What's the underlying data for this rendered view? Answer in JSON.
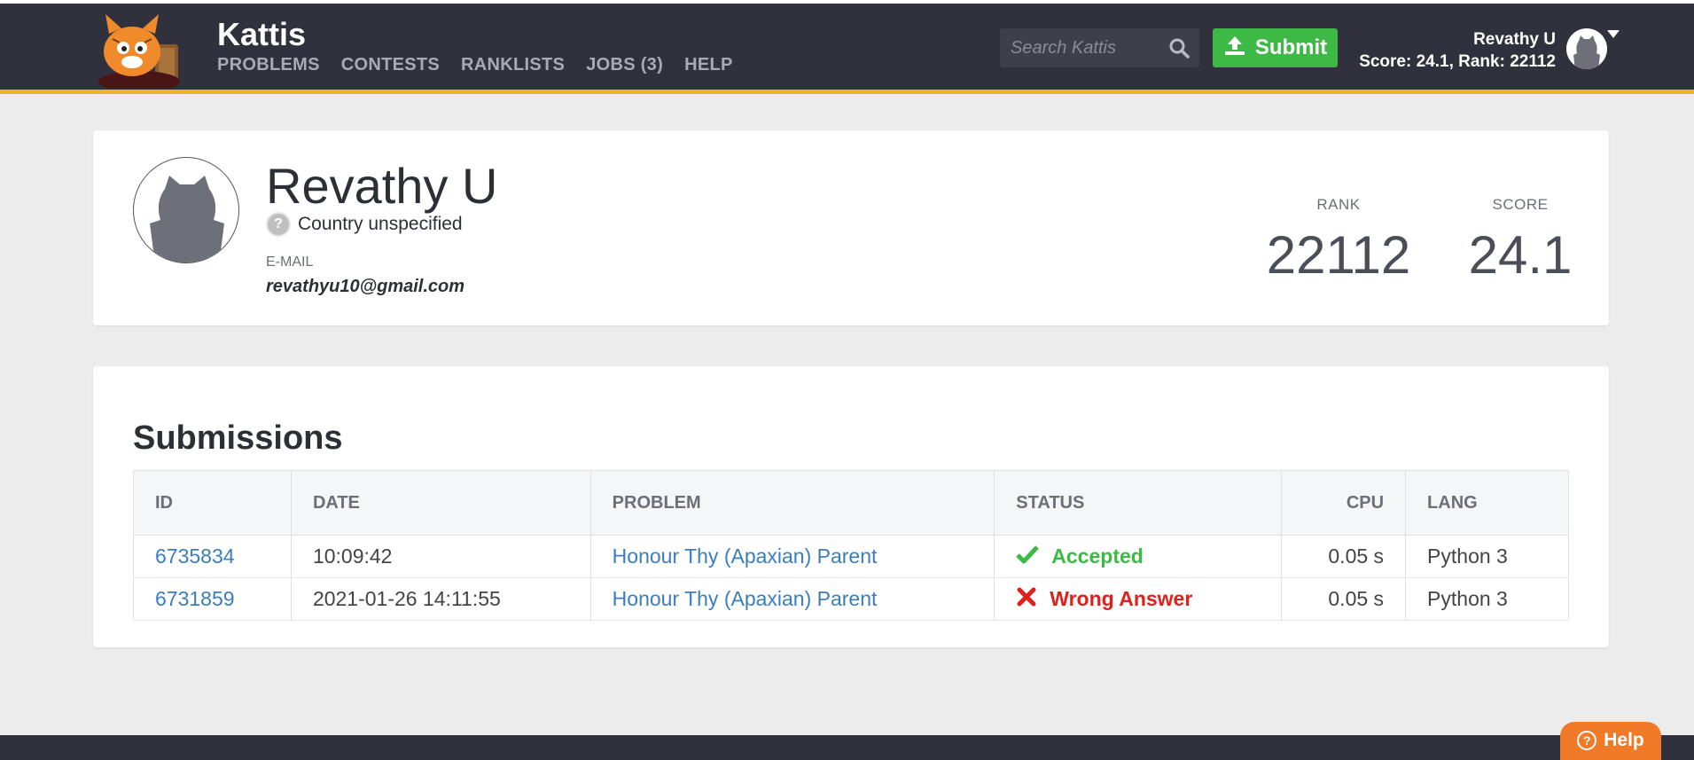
{
  "brand": "Kattis",
  "nav": [
    "PROBLEMS",
    "CONTESTS",
    "RANKLISTS",
    "JOBS (3)",
    "HELP"
  ],
  "search": {
    "placeholder": "Search Kattis"
  },
  "submit_label": "Submit",
  "user": {
    "name": "Revathy U",
    "stats_line": "Score: 24.1, Rank: 22112"
  },
  "profile": {
    "name": "Revathy U",
    "country": "Country unspecified",
    "email_label": "E-MAIL",
    "email": "revathyu10@gmail.com",
    "rank_label": "RANK",
    "rank": "22112",
    "score_label": "SCORE",
    "score": "24.1"
  },
  "submissions": {
    "title": "Submissions",
    "columns": [
      "ID",
      "DATE",
      "PROBLEM",
      "STATUS",
      "CPU",
      "LANG"
    ],
    "rows": [
      {
        "id": "6735834",
        "date": "10:09:42",
        "problem": "Honour Thy (Apaxian) Parent",
        "status": "Accepted",
        "cpu": "0.05 s",
        "lang": "Python 3"
      },
      {
        "id": "6731859",
        "date": "2021-01-26 14:11:55",
        "problem": "Honour Thy (Apaxian) Parent",
        "status": "Wrong Answer",
        "cpu": "0.05 s",
        "lang": "Python 3"
      }
    ]
  },
  "help_label": "Help",
  "colors": {
    "accepted": "#3dba45",
    "wrong": "#e0201c",
    "accent": "#f0b030",
    "link": "#3a7dc0"
  }
}
